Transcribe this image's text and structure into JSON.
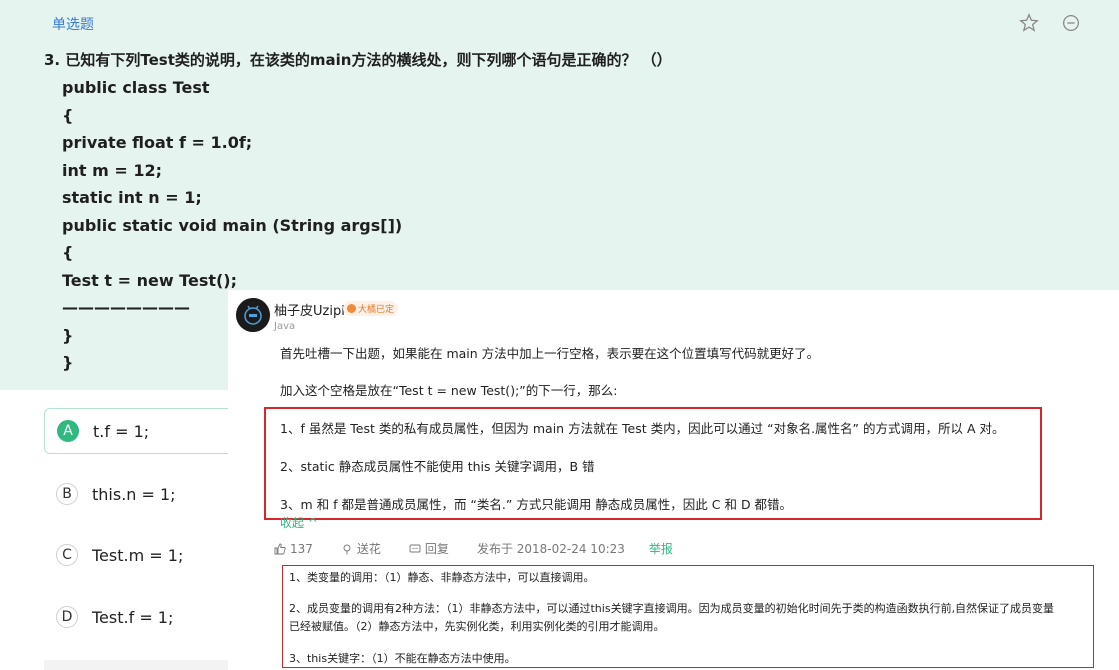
{
  "question": {
    "type_label": "单选题",
    "title": "3. 已知有下列Test类的说明，在该类的main方法的横线处，则下列哪个语句是正确的？ （）",
    "code_lines": [
      "public class Test",
      "{",
      "private float f = 1.0f;",
      "int m = 12;",
      "static int n = 1;",
      "public static void main (String args[])",
      "{",
      "Test t = new Test();",
      "————————",
      "}",
      "}"
    ]
  },
  "options": [
    {
      "letter": "A",
      "text": "t.f = 1;",
      "selected": true
    },
    {
      "letter": "B",
      "text": "this.n = 1;",
      "selected": false
    },
    {
      "letter": "C",
      "text": "Test.m = 1;",
      "selected": false
    },
    {
      "letter": "D",
      "text": "Test.f = 1;",
      "selected": false
    }
  ],
  "comment": {
    "username": "柚子皮Uzipi",
    "badge": "大橘已定",
    "lang": "Java",
    "paragraphs": [
      "首先吐槽一下出题，如果能在 main 方法中加上一行空格，表示要在这个位置填写代码就更好了。",
      "加入这个空格是放在“Test t = new Test();”的下一行，那么:",
      "1、f 虽然是 Test 类的私有成员属性，但因为 main 方法就在 Test 类内，因此可以通过 “对象名.属性名” 的方式调用，所以 A 对。",
      "2、static 静态成员属性不能使用 this 关键字调用，B 错",
      "3、m 和 f 都是普通成员属性，而 “类名.” 方式只能调用 静态成员属性，因此 C 和 D 都错。"
    ],
    "collapse_label": "收起 ^",
    "likes": "137",
    "flower_label": "送花",
    "reply_label": "回复",
    "published": "发布于 2018-02-24 10:23",
    "report_label": "举报"
  },
  "note": {
    "lines": [
      "1、类变量的调用：（1）静态、非静态方法中，可以直接调用。",
      "2、成员变量的调用有2种方法：（1）非静态方法中，可以通过this关键字直接调用。因为成员变量的初始化时间先于类的构造函数执行前,自然保证了成员变量",
      "已经被赋值。（2）静态方法中，先实例化类，利用实例化类的引用才能调用。",
      "3、this关键字：（1）不能在静态方法中使用。"
    ]
  }
}
